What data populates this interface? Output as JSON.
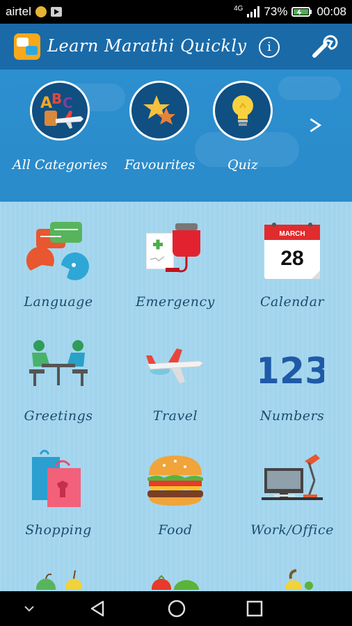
{
  "status_bar": {
    "carrier": "airtel",
    "network": "4G",
    "battery": "73%",
    "time": "00:08"
  },
  "app_bar": {
    "title": "Learn Marathi Quickly",
    "info_icon": "info-icon",
    "settings_icon": "wrench-icon"
  },
  "top_menu": {
    "items": [
      {
        "label": "All Categories",
        "icon": "abc-plane-icon"
      },
      {
        "label": "Favourites",
        "icon": "stars-icon"
      },
      {
        "label": "Quiz",
        "icon": "lightbulb-icon"
      }
    ],
    "next_icon": "chevron-right-icon"
  },
  "categories": [
    {
      "label": "Language",
      "icon": "chat-bubbles-icon"
    },
    {
      "label": "Emergency",
      "icon": "medical-drip-icon"
    },
    {
      "label": "Calendar",
      "icon": "calendar-icon",
      "month": "MARCH",
      "day": "28"
    },
    {
      "label": "Greetings",
      "icon": "people-meeting-icon"
    },
    {
      "label": "Travel",
      "icon": "airplane-icon"
    },
    {
      "label": "Numbers",
      "icon": "numbers-icon",
      "digits": "123"
    },
    {
      "label": "Shopping",
      "icon": "shopping-bags-icon"
    },
    {
      "label": "Food",
      "icon": "burger-icon"
    },
    {
      "label": "Work/Office",
      "icon": "office-desk-icon"
    }
  ],
  "colors": {
    "app_bar": "#1a6aa8",
    "banner": "#2c8fcf",
    "grid_bg": "#a2d5ed",
    "label": "#1d4a6e"
  }
}
